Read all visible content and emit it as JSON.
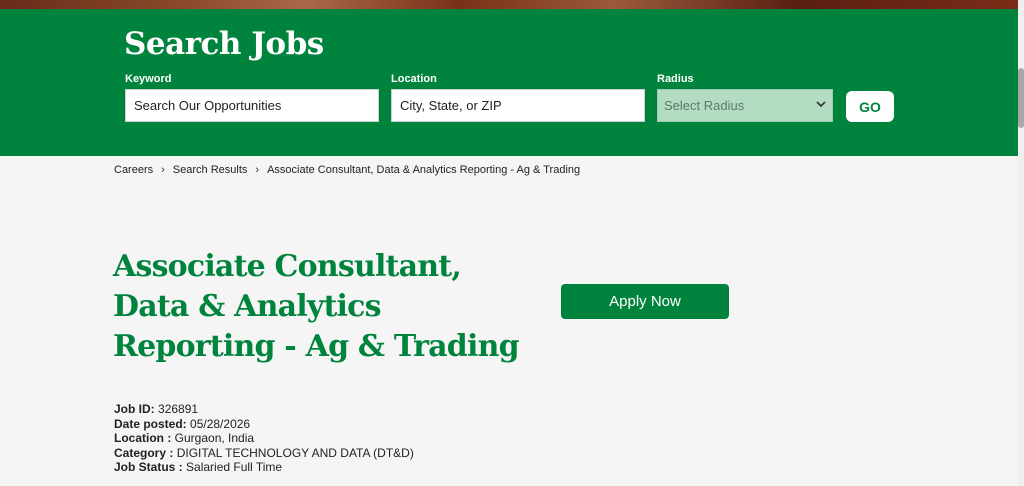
{
  "hero": {
    "title": "Search Jobs",
    "keyword_label": "Keyword",
    "keyword_placeholder": "Search Our Opportunities",
    "location_label": "Location",
    "location_placeholder": "City, State, or ZIP",
    "radius_label": "Radius",
    "radius_selected": "Select Radius",
    "go_label": "GO"
  },
  "breadcrumb": {
    "items": [
      "Careers",
      "Search Results",
      "Associate Consultant, Data & Analytics Reporting - Ag & Trading"
    ]
  },
  "job": {
    "title": "Associate Consultant, Data & Analytics Reporting - Ag & Trading",
    "apply_label": "Apply Now",
    "details": [
      {
        "key": "Job ID:",
        "value": "326891"
      },
      {
        "key": "Date posted:",
        "value": "05/28/2026"
      },
      {
        "key": "Location :",
        "value": "Gurgaon, India"
      },
      {
        "key": "Category :",
        "value": "DIGITAL TECHNOLOGY AND DATA (DT&D)"
      },
      {
        "key": "Job Status :",
        "value": "Salaried Full Time"
      }
    ]
  },
  "colors": {
    "brand_green": "#00843d",
    "radius_bg": "#b4dcc3",
    "page_bg": "#f5f5f5"
  },
  "icons": {
    "radius_dropdown": "chevron-down-icon",
    "breadcrumb_separator": "chevron-right-icon"
  }
}
